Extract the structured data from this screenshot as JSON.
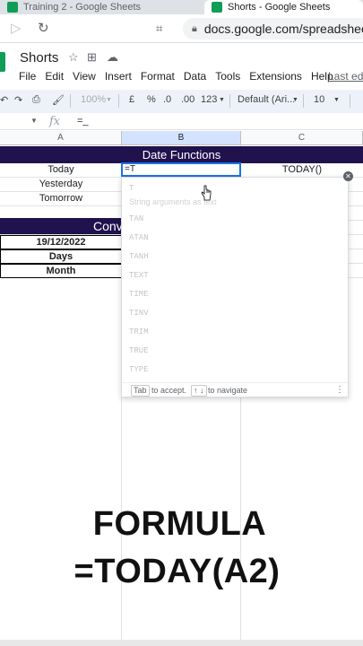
{
  "browser": {
    "tabs": [
      {
        "title": "Training 2 - Google Sheets"
      },
      {
        "title": "Shorts - Google Sheets"
      }
    ],
    "url": "docs.google.com/spreadsheets"
  },
  "sheet": {
    "title": "Shorts",
    "menu": [
      "File",
      "Edit",
      "View",
      "Insert",
      "Format",
      "Data",
      "Tools",
      "Extensions",
      "Help"
    ],
    "last_edit": "Last edit",
    "toolbar": {
      "zoom": "100%",
      "currency": "£",
      "percent": "%",
      "dec_decrease": ".0",
      "dec_increase": ".00",
      "format_more": "123",
      "font": "Default (Ari...",
      "font_size": "10"
    },
    "formula_bar": {
      "value": "=_"
    },
    "columns": [
      "A",
      "B",
      "C"
    ],
    "banner_title": "Date Functions",
    "rows": [
      {
        "label": "Today",
        "formula": "=T",
        "result": "TODAY()"
      },
      {
        "label": "Yesterday"
      },
      {
        "label": "Tomorrow"
      }
    ],
    "second_banner": "Conv",
    "second_section": [
      "19/12/2022",
      "Days",
      "Month"
    ]
  },
  "autocomplete": {
    "items": [
      "T",
      "TAN",
      "ATAN",
      "TANH",
      "TEXT",
      "TIME",
      "TINV",
      "TRIM",
      "TRUE",
      "TYPE"
    ],
    "hint": "String arguments as text",
    "footer_accept_key": "Tab",
    "footer_accept": "to accept.",
    "footer_nav_keys": "↑ ↓",
    "footer_nav": "to navigate"
  },
  "caption": {
    "line1": "FORMULA",
    "line2": "=TODAY(A2)"
  }
}
